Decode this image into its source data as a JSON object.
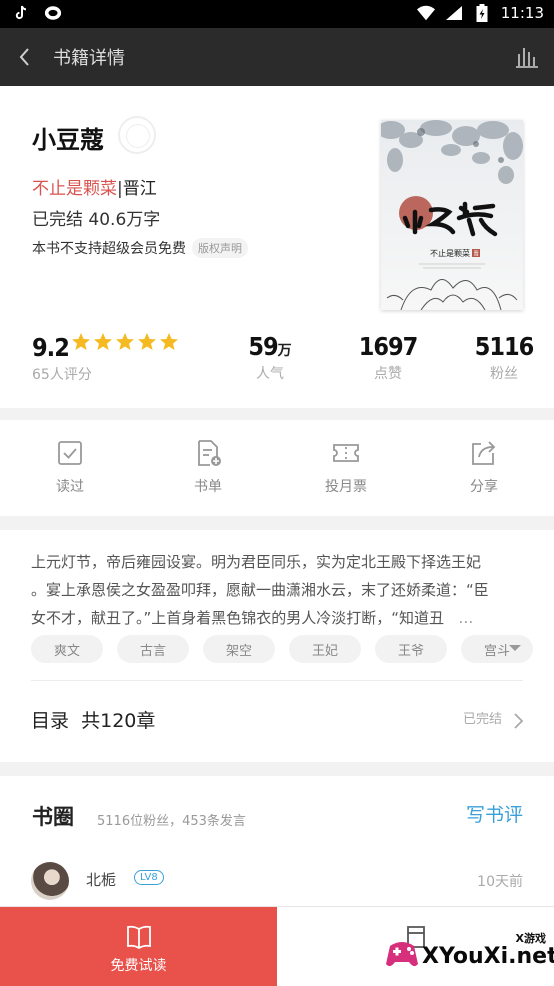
{
  "status_bar": {
    "time": "11:13",
    "left_icons": [
      "tiktok-icon",
      "chat-bubble-icon"
    ],
    "right_icons": [
      "wifi-icon",
      "signal-icon",
      "battery-charging-icon"
    ]
  },
  "app_bar": {
    "title": "书籍详情",
    "back_icon": "chevron-left-icon",
    "action_icon": "bar-chart-icon"
  },
  "book": {
    "title": "小豆蔻",
    "author": "不止是颗菜",
    "separator": "|",
    "platform": "晋江",
    "status": "已完结 40.6万字",
    "vip_notice": "本书不支持超级会员免费",
    "copyright_tag": "版权声明",
    "cover": {
      "title_text": "小豆蔻",
      "author_text": "不止是颗菜",
      "seal_text": "晋"
    }
  },
  "stats": {
    "rating": "9.2",
    "rating_count": "65人评分",
    "stars": 5,
    "popularity_value": "59",
    "popularity_unit": "万",
    "popularity_label": "人气",
    "likes_value": "1697",
    "likes_label": "点赞",
    "fans_value": "5116",
    "fans_label": "粉丝"
  },
  "actions": [
    {
      "label": "读过",
      "icon": "checkbox-icon"
    },
    {
      "label": "书单",
      "icon": "document-add-icon"
    },
    {
      "label": "投月票",
      "icon": "ticket-icon"
    },
    {
      "label": "分享",
      "icon": "share-icon"
    }
  ],
  "synopsis": {
    "line1": "上元灯节，帝后雍园设宴。明为君臣同乐，实为定北王殿下择选王妃",
    "line2": "。宴上承恩侯之女盈盈叩拜，愿献一曲潇湘水云，末了还娇柔道：“臣",
    "line3": "女不才，献丑了。”上首身着黑色锦衣的男人冷淡打断，“知道丑",
    "ellipsis": "…"
  },
  "tags": [
    "爽文",
    "古言",
    "架空",
    "王妃",
    "王爷",
    "宫斗"
  ],
  "toc": {
    "label": "目录",
    "chapters": "共120章",
    "status": "已完结"
  },
  "circle": {
    "title": "书圈",
    "meta": "5116位粉丝，453条发言",
    "write_review": "写书评",
    "post": {
      "user": "北栀",
      "level": "LV8",
      "time": "10天前"
    }
  },
  "bottom_bar": {
    "read_label": "免费试读",
    "read_icon": "open-book-icon",
    "shelf_icon": "bookshelf-icon"
  },
  "watermark": {
    "top_text": "X游戏",
    "main_text": "XYouXi.net"
  },
  "colors": {
    "accent_red": "#e8524a",
    "author_red": "#d9534f",
    "link_blue": "#3aa0d8",
    "star_gold": "#f5b921"
  }
}
